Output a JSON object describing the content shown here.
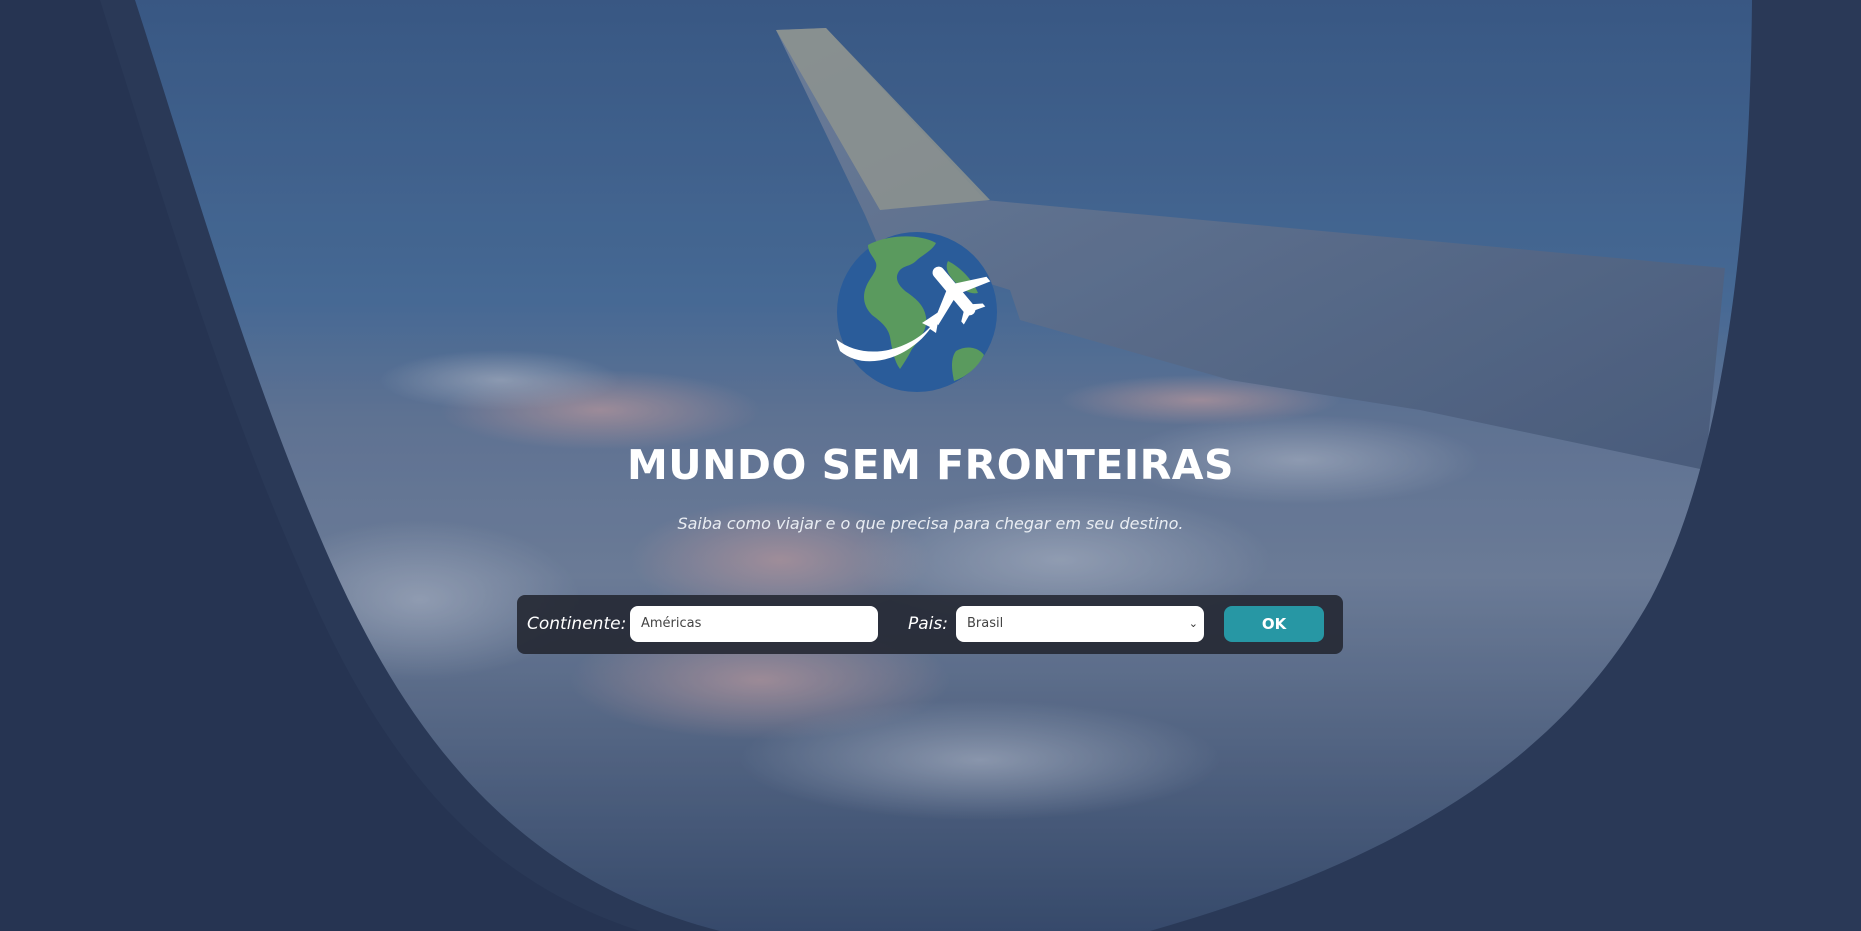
{
  "hero": {
    "title": "MUNDO SEM FRONTEIRAS",
    "subtitle": "Saiba como viajar e o que precisa para chegar em seu destino."
  },
  "form": {
    "continent_label": "Continente:",
    "continent_value": "Américas",
    "country_label": "Pais:",
    "country_value": "Brasil",
    "submit_label": "OK"
  },
  "icons": {
    "logo": "globe-airplane-icon",
    "select_chevron": "chevron-down-icon"
  },
  "colors": {
    "accent": "#2797a4",
    "form_bar": "#222630",
    "globe_ocean": "#2a5c9a",
    "globe_land": "#5a9a5e"
  }
}
